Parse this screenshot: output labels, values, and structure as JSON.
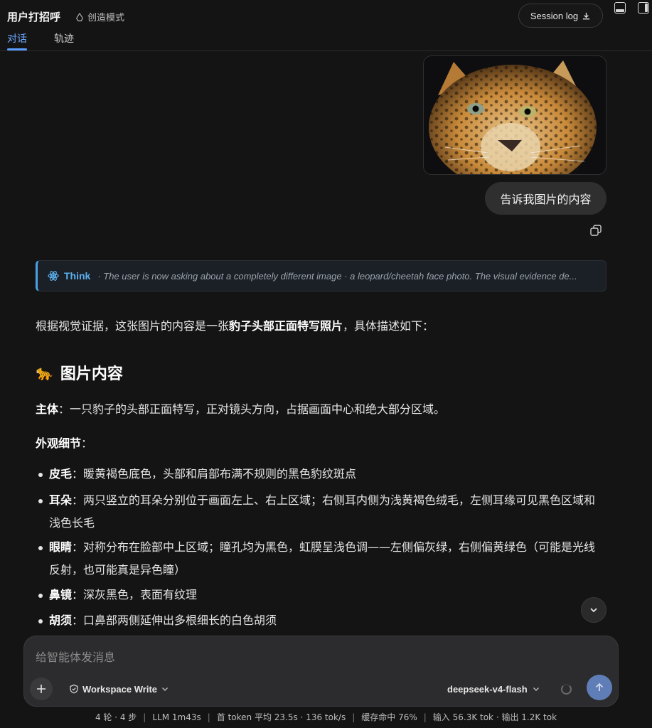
{
  "header": {
    "title": "用户打招呼",
    "mode_label": "创造模式",
    "session_log_label": "Session log",
    "tabs": [
      {
        "label": "对话",
        "active": true
      },
      {
        "label": "轨迹",
        "active": false
      }
    ]
  },
  "conversation": {
    "user_image_icon": "leopard-photo",
    "user_message": "告诉我图片的内容",
    "think": {
      "label": "Think",
      "text": "· The user is now asking about a completely different image · a leopard/cheetah face photo. The visual evidence de..."
    },
    "intro": {
      "prefix": "根据视觉证据，这张图片的内容是一张",
      "bold": "豹子头部正面特写照片",
      "suffix": "，具体描述如下："
    },
    "section_title": "图片内容",
    "section_emoji": "🐆",
    "subject": {
      "label": "主体",
      "text": "：一只豹子的头部正面特写，正对镜头方向，占据画面中心和绝大部分区域。"
    },
    "details_label": "外观细节",
    "details_suffix": "：",
    "bullets": [
      {
        "label": "皮毛",
        "text": "：暖黄褐色底色，头部和肩部布满不规则的黑色豹纹斑点"
      },
      {
        "label": "耳朵",
        "text": "：两只竖立的耳朵分别位于画面左上、右上区域；右侧耳内侧为浅黄褐色绒毛，左侧耳缘可见黑色区域和浅色长毛"
      },
      {
        "label": "眼睛",
        "text": "：对称分布在脸部中上区域；瞳孔均为黑色，虹膜呈浅色调——左侧偏灰绿，右侧偏黄绿色（可能是光线反射，也可能真是异色瞳）"
      },
      {
        "label": "鼻镜",
        "text": "：深灰黑色，表面有纹理"
      },
      {
        "label": "胡须",
        "text": "：口鼻部两侧延伸出多根细长的白色胡须"
      }
    ]
  },
  "composer": {
    "placeholder": "给智能体发消息",
    "workspace_label": "Workspace Write",
    "model_label": "deepseek-v4-flash"
  },
  "status_bar": {
    "items": [
      "4 轮 · 4 步",
      "LLM 1m43s",
      "首 token 平均 23.5s · 136 tok/s",
      "缓存命中 76%",
      "输入 56.3K tok · 输出 1.2K tok"
    ],
    "separator": "|"
  },
  "colors": {
    "background": "#141414",
    "accent": "#5b9cff",
    "think_accent": "#4aa3e6",
    "send_button": "#5f7eb8"
  }
}
